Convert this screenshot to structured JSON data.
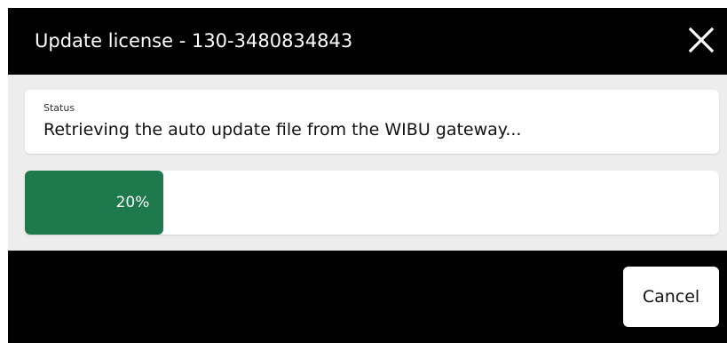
{
  "dialog": {
    "title": "Update license - 130-3480834843",
    "close_icon": "close-icon"
  },
  "status": {
    "label": "Status",
    "message": "Retrieving the auto update file from the WIBU gateway..."
  },
  "progress": {
    "percent": 20,
    "label": "20%",
    "color": "#1e7a4c"
  },
  "footer": {
    "cancel_label": "Cancel"
  }
}
